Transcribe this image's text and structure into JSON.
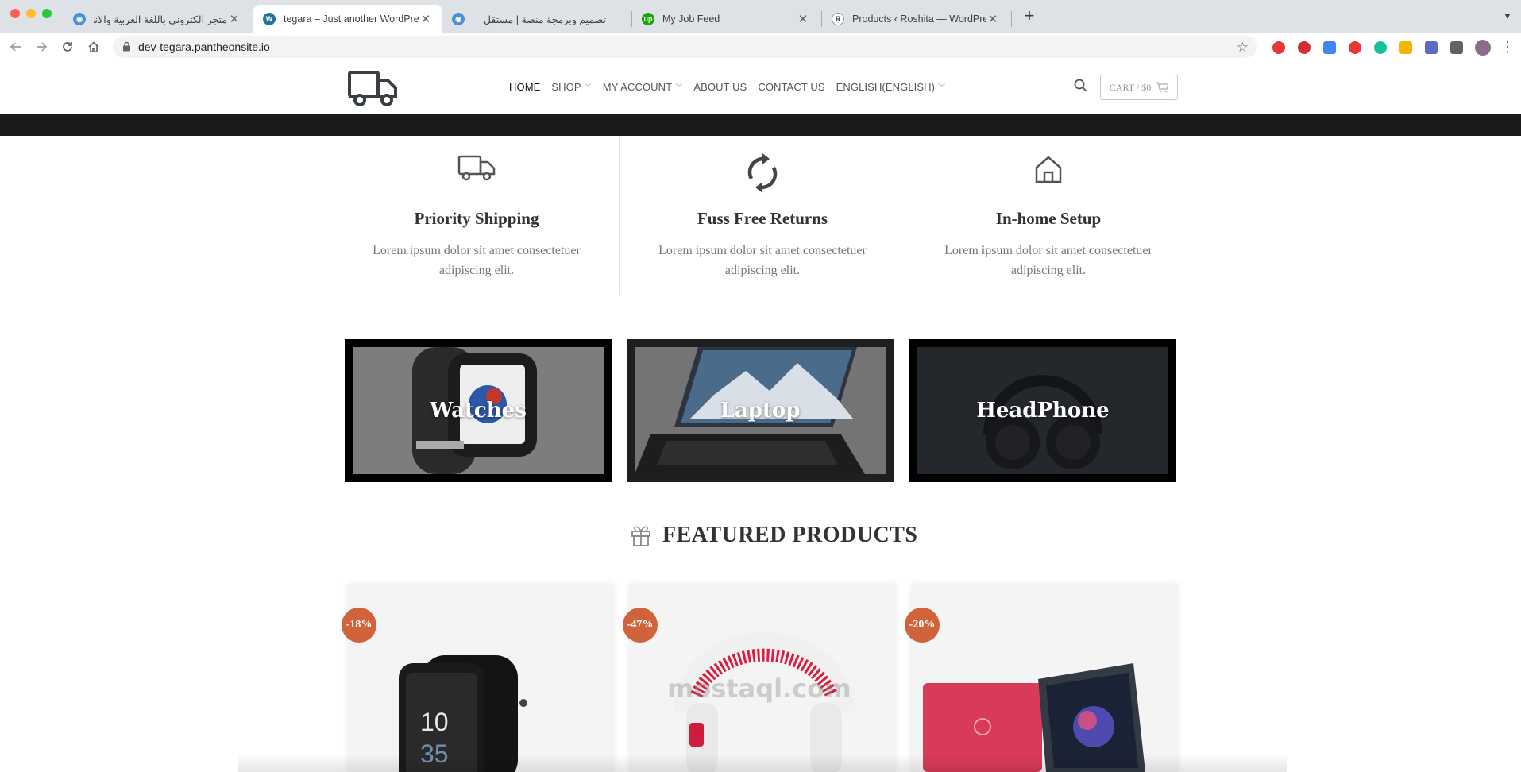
{
  "browser": {
    "tabs": [
      {
        "title": "متجر الكتروني باللغة العربية والانجليز",
        "active": false
      },
      {
        "title": "tegara – Just another WordPress",
        "active": true
      },
      {
        "title": "تصميم وبرمجة منصة | مستقل",
        "active": false
      },
      {
        "title": "My Job Feed",
        "active": false
      },
      {
        "title": "Products ‹ Roshita — WordPress",
        "active": false
      }
    ],
    "url": "dev-tegara.pantheonsite.io",
    "extensions": [
      "ABP",
      "shield",
      "translate",
      "mail",
      "grammarly",
      "broom",
      "dropper",
      "puzzle",
      "avatar"
    ]
  },
  "header": {
    "nav": [
      {
        "label": "HOME",
        "dropdown": false,
        "active": true
      },
      {
        "label": "SHOP",
        "dropdown": true,
        "active": false
      },
      {
        "label": "MY ACCOUNT",
        "dropdown": true,
        "active": false
      },
      {
        "label": "ABOUT US",
        "dropdown": false,
        "active": false
      },
      {
        "label": "CONTACT US",
        "dropdown": false,
        "active": false
      },
      {
        "label": "ENGLISH(ENGLISH)",
        "dropdown": true,
        "active": false
      }
    ],
    "cart_label": "CART / $0"
  },
  "features": [
    {
      "title": "Priority Shipping",
      "text": "Lorem ipsum dolor sit amet consectetuer adipiscing elit.",
      "icon": "truck-icon"
    },
    {
      "title": "Fuss Free Returns",
      "text": "Lorem ipsum dolor sit amet consectetuer adipiscing elit.",
      "icon": "refresh-icon"
    },
    {
      "title": "In-home Setup",
      "text": "Lorem ipsum dolor sit amet consectetuer adipiscing elit.",
      "icon": "home-icon"
    }
  ],
  "categories": [
    {
      "label": "Watches"
    },
    {
      "label": "Laptop"
    },
    {
      "label": "HeadPhone"
    }
  ],
  "featured": {
    "title": "FEATURED PRODUCTS",
    "products": [
      {
        "badge": "-18%",
        "image": "smartwatch"
      },
      {
        "badge": "-47%",
        "image": "headphones"
      },
      {
        "badge": "-20%",
        "image": "laptops"
      }
    ]
  },
  "watermark": "mostaql.com",
  "colors": {
    "badge": "#d1633c",
    "dark_strip": "#1b1b1b"
  }
}
